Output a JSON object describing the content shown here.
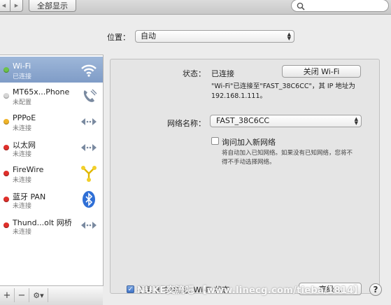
{
  "toolbar": {
    "show_all_label": "全部显示",
    "back_glyph": "◀",
    "forward_glyph": "▶",
    "search_icon": "magnifier"
  },
  "location": {
    "label": "位置：",
    "value": "自动"
  },
  "sidebar": {
    "services": [
      {
        "name": "Wi-Fi",
        "status": "已连接",
        "dot": "#6cc24a",
        "icon": "wifi-icon",
        "selected": true
      },
      {
        "name": "MT65x...Phone",
        "status": "未配置",
        "dot": "#d6d6d6",
        "icon": "phone-icon",
        "selected": false
      },
      {
        "name": "PPPoE",
        "status": "未连接",
        "dot": "#f0b429",
        "icon": "ethernet-arrows-icon",
        "selected": false
      },
      {
        "name": "以太网",
        "status": "未连接",
        "dot": "#e0302b",
        "icon": "ethernet-arrows-icon",
        "selected": false
      },
      {
        "name": "FireWire",
        "status": "未连接",
        "dot": "#e0302b",
        "icon": "firewire-icon",
        "selected": false
      },
      {
        "name": "蓝牙 PAN",
        "status": "未连接",
        "dot": "#e0302b",
        "icon": "bluetooth-icon",
        "selected": false
      },
      {
        "name": "Thund...olt 网桥",
        "status": "未连接",
        "dot": "#e0302b",
        "icon": "ethernet-arrows-icon",
        "selected": false
      }
    ],
    "add_label": "+",
    "remove_label": "−",
    "action_label": "⚙▾"
  },
  "detail": {
    "status_label": "状态：",
    "status_value": "已连接",
    "wifi_off_button": "关闭 Wi-Fi",
    "status_desc_1": "\"Wi-Fi\"已连接至\"FAST_38C6CC\"，其 IP 地址为",
    "status_desc_2": "192.168.1.111。",
    "network_label": "网络名称：",
    "network_value": "FAST_38C6CC",
    "ask_join_label": "询问加入新网络",
    "ask_join_desc_1": "将自动加入已知网络。如果没有已知网络，您将不",
    "ask_join_desc_2": "得不手动选择网络。",
    "menu_bar_label": "在菜单栏中显示 Wi-Fi 状态",
    "advanced_button": "高级...",
    "help_label": "?"
  },
  "watermark": "NUKE交流吧 【www.linecg.com/tieba/1814】",
  "colors": {
    "selected_row": "#8aa6cf",
    "connected": "#6cc24a",
    "disconnected": "#e0302b",
    "pending": "#f0b429"
  }
}
